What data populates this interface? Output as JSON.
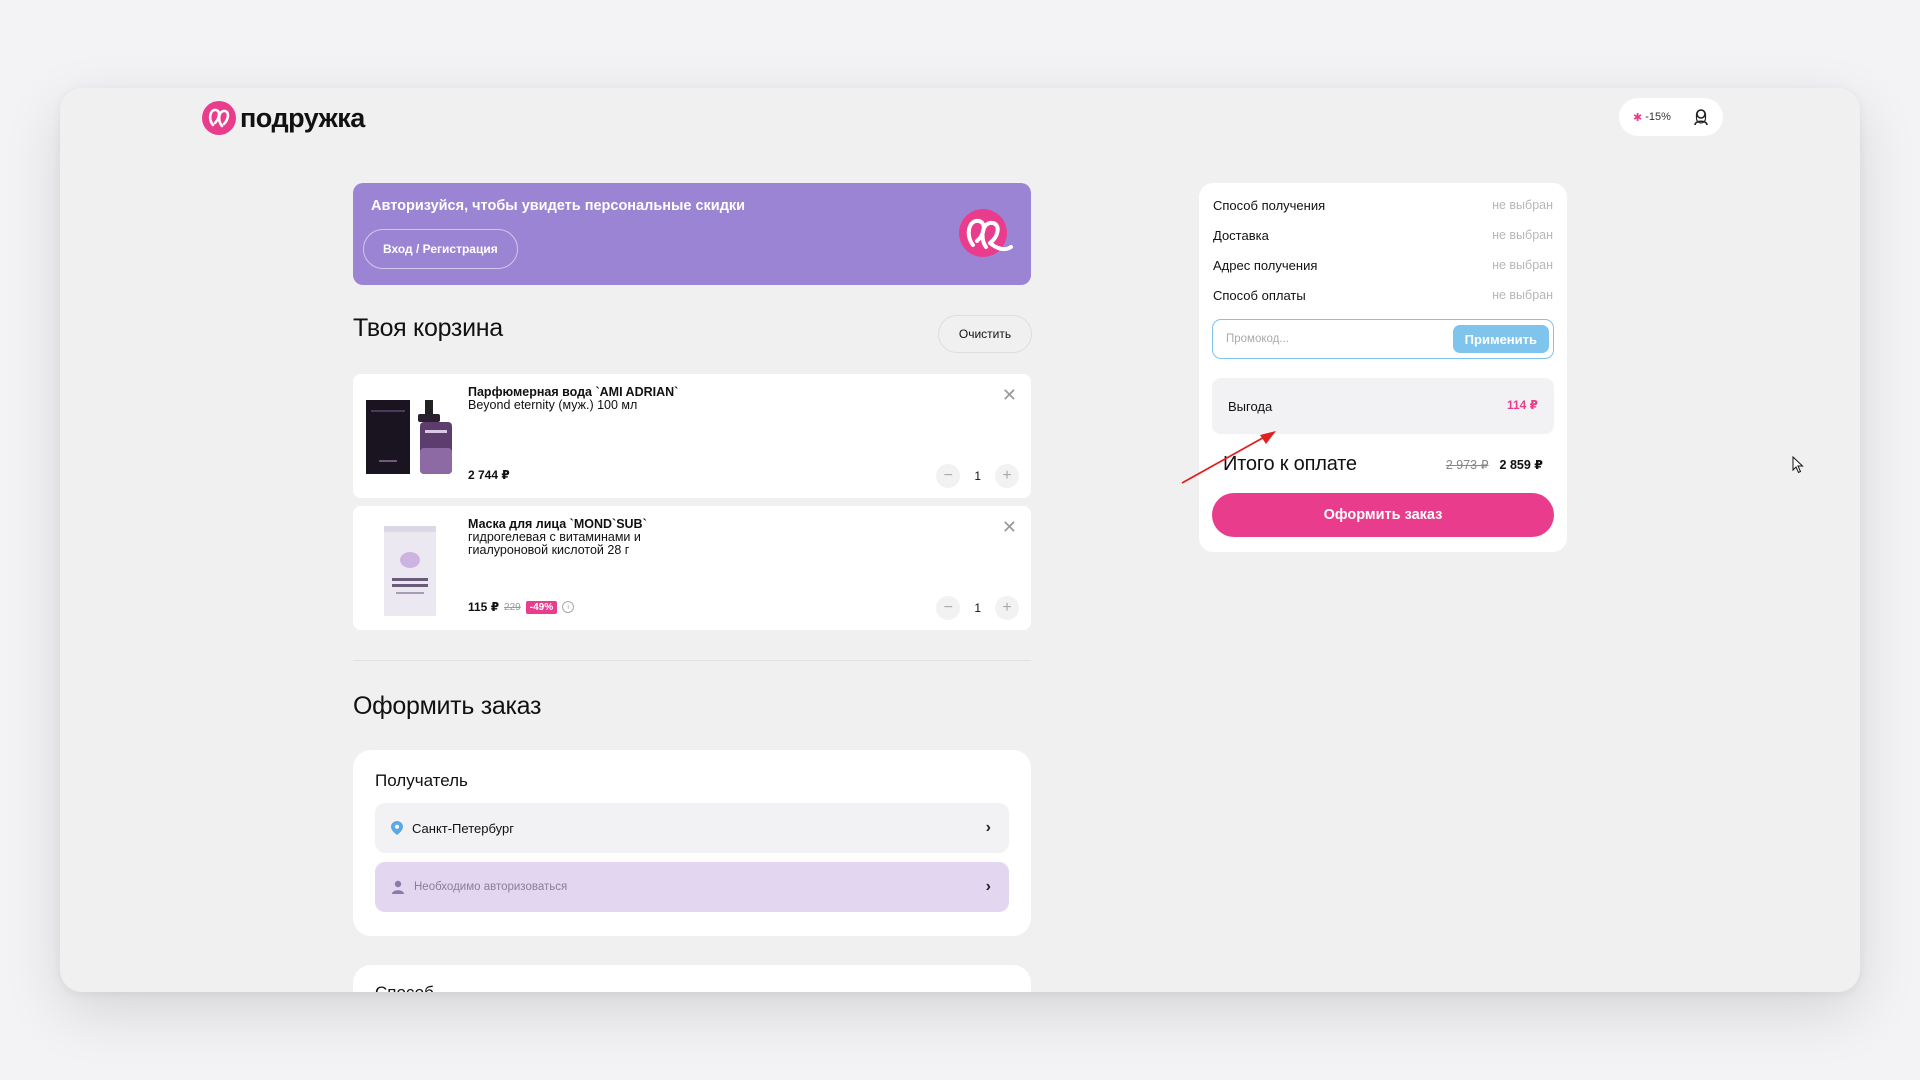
{
  "header": {
    "logo_text": "подружка",
    "promo_badge": "-15%"
  },
  "banner": {
    "text": "Авторизуйся, чтобы увидеть персональные скидки",
    "login_button": "Вход / Регистрация"
  },
  "cart": {
    "title": "Твоя корзина",
    "clear_label": "Очистить",
    "items": [
      {
        "name_line1": "Парфюмерная вода `AMI ADRIAN`",
        "name_line2": "Beyond eternity (муж.) 100 мл",
        "price": "2 744 ₽",
        "quantity": "1"
      },
      {
        "name_line1": "Маска для лица `MOND`SUB`",
        "name_line2": "гидрогелевая с витаминами и",
        "name_line3": "гиалуроновой кислотой 28 г",
        "price": "115 ₽",
        "old_price": "229",
        "discount": "-49%",
        "quantity": "1"
      }
    ]
  },
  "order": {
    "title": "Оформить заказ",
    "recipient_title": "Получатель",
    "city": "Санкт-Петербург",
    "auth_required": "Необходимо авторизоваться",
    "next_section_title": "Способ"
  },
  "summary": {
    "rows": [
      {
        "label": "Способ получения",
        "value": "не выбран"
      },
      {
        "label": "Доставка",
        "value": "не выбран"
      },
      {
        "label": "Адрес получения",
        "value": "не выбран"
      },
      {
        "label": "Способ оплаты",
        "value": "не выбран"
      }
    ],
    "promo_placeholder": "Промокод...",
    "apply_label": "Применить",
    "benefit_label": "Выгода",
    "benefit_value": "114 ₽",
    "total_label": "Итого к оплате",
    "total_old": "2 973 ₽",
    "total_new": "2 859 ₽",
    "checkout_label": "Оформить заказ"
  },
  "colors": {
    "brand_pink": "#ea3c8c",
    "banner_purple": "#9c84d4",
    "apply_blue": "#7fc4ec",
    "auth_row_bg": "#e3d6f0"
  },
  "icons": [
    "logo-icon",
    "star-icon",
    "user-icon",
    "close-icon",
    "minus-icon",
    "plus-icon",
    "location-pin-icon",
    "person-icon",
    "chevron-right-icon",
    "info-icon",
    "arrow-annotation-icon",
    "mouse-cursor-icon"
  ]
}
